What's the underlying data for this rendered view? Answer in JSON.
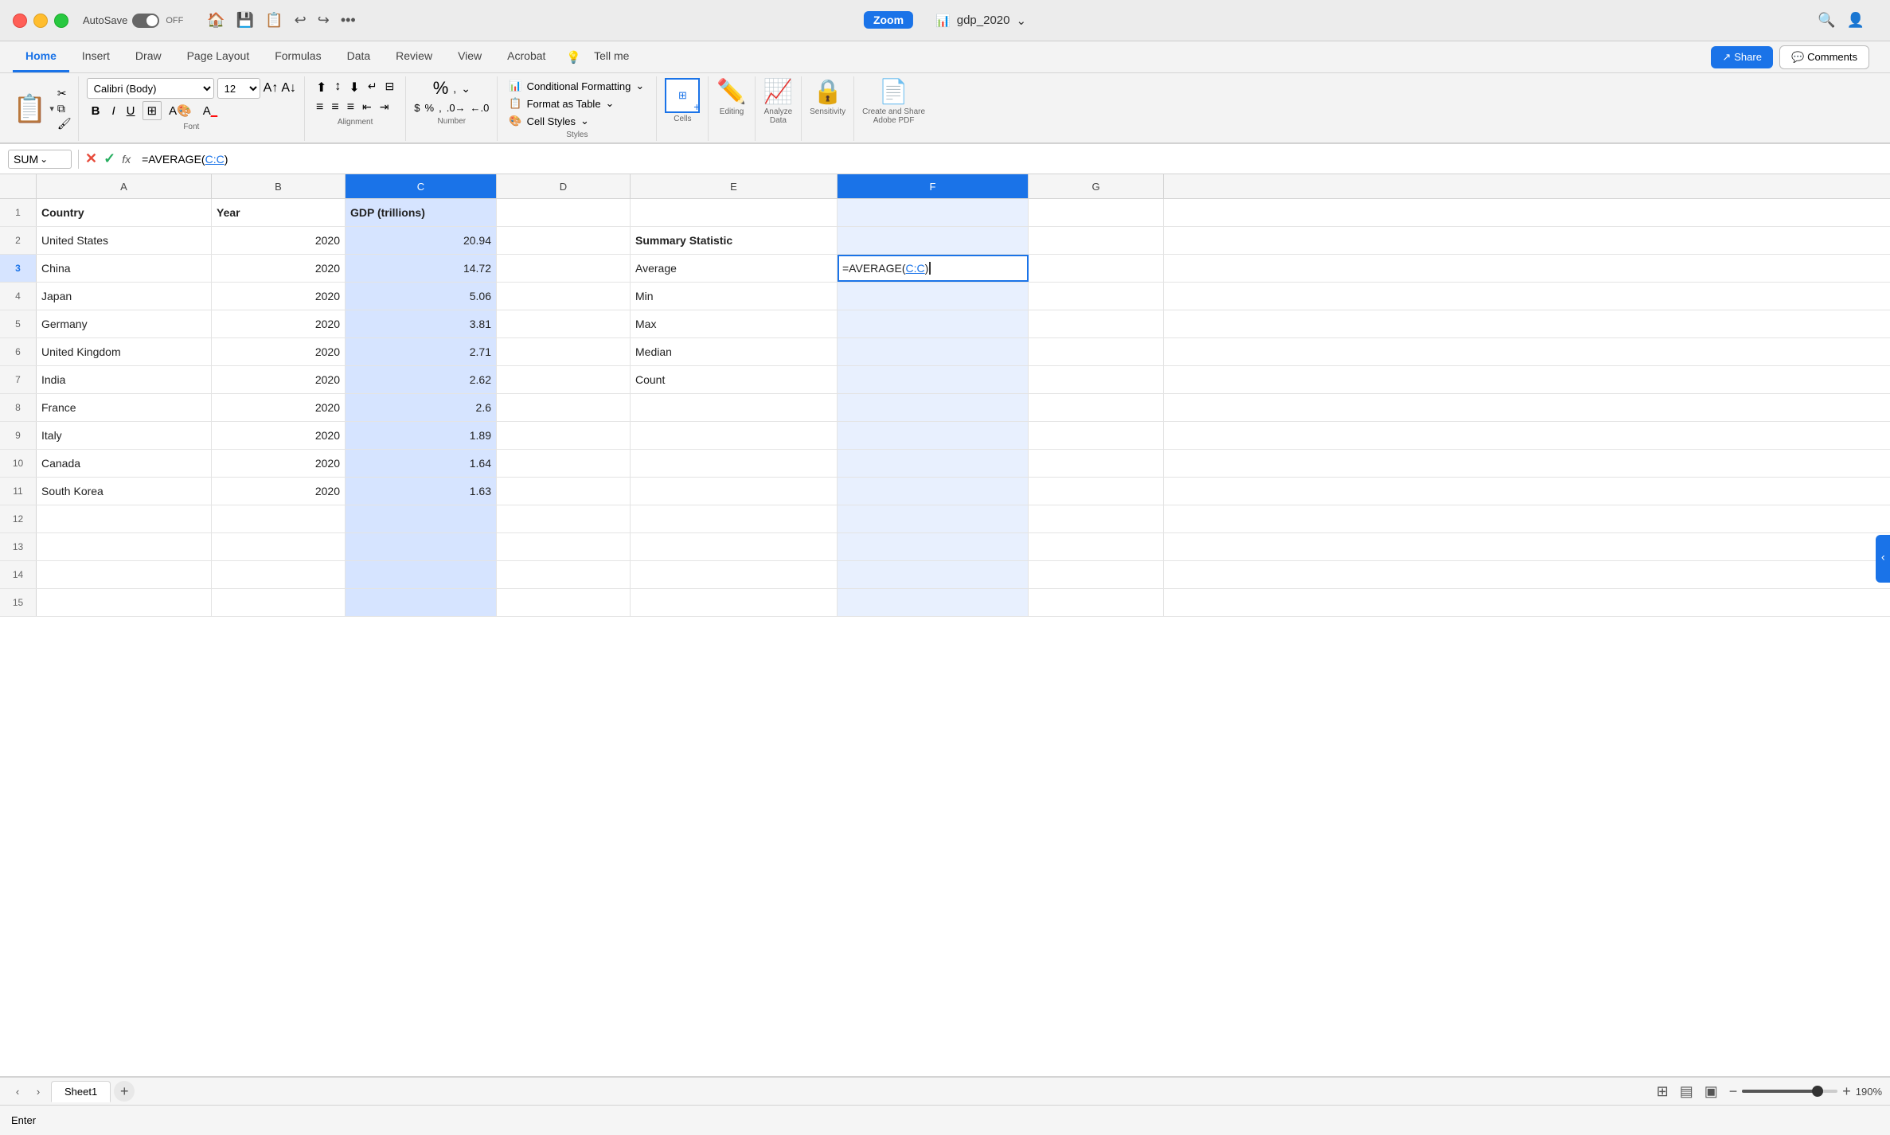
{
  "titleBar": {
    "appName": "AutoSave",
    "toggleState": "OFF",
    "fileName": "gdp_2020",
    "zoomApp": "Zoom",
    "icons": [
      "home",
      "save",
      "save-as",
      "back",
      "forward",
      "ellipsis"
    ]
  },
  "ribbon": {
    "tabs": [
      "Home",
      "Insert",
      "Draw",
      "Page Layout",
      "Formulas",
      "Data",
      "Review",
      "View",
      "Acrobat",
      "Tell me"
    ],
    "activeTab": "Home",
    "share": "Share",
    "comments": "Comments",
    "groups": {
      "paste": "Paste",
      "font": {
        "family": "Calibri (Body)",
        "size": "12"
      },
      "number": "Number",
      "styles": {
        "conditionalFormatting": "Conditional Formatting",
        "formatAsTable": "Format as Table",
        "cellStyles": "Cell Styles"
      },
      "cells": "Cells",
      "editing": "Editing",
      "analyzeData": "Analyze Data",
      "sensitivity": "Sensitivity",
      "createShare": "Create and Share Adobe PDF"
    }
  },
  "formulaBar": {
    "cellRef": "SUM",
    "formula": "=AVERAGE(C:C)"
  },
  "columns": {
    "headers": [
      "A",
      "B",
      "C",
      "D",
      "E",
      "F",
      "G"
    ],
    "widths": [
      220,
      168,
      190,
      168,
      260,
      240,
      170
    ]
  },
  "rows": [
    {
      "num": 1,
      "cells": [
        "Country",
        "Year",
        "GDP (trillions)",
        "",
        "",
        "",
        ""
      ]
    },
    {
      "num": 2,
      "cells": [
        "United States",
        "2020",
        "20.94",
        "",
        "Summary Statistic",
        "",
        ""
      ]
    },
    {
      "num": 3,
      "cells": [
        "China",
        "2020",
        "14.72",
        "",
        "Average",
        "=AVERAGE(C:C)",
        ""
      ]
    },
    {
      "num": 4,
      "cells": [
        "Japan",
        "2020",
        "5.06",
        "",
        "Min",
        "",
        ""
      ]
    },
    {
      "num": 5,
      "cells": [
        "Germany",
        "2020",
        "3.81",
        "",
        "Max",
        "",
        ""
      ]
    },
    {
      "num": 6,
      "cells": [
        "United Kingdom",
        "2020",
        "2.71",
        "",
        "Median",
        "",
        ""
      ]
    },
    {
      "num": 7,
      "cells": [
        "India",
        "2020",
        "2.62",
        "",
        "Count",
        "",
        ""
      ]
    },
    {
      "num": 8,
      "cells": [
        "France",
        "2020",
        "2.6",
        "",
        "",
        "",
        ""
      ]
    },
    {
      "num": 9,
      "cells": [
        "Italy",
        "2020",
        "1.89",
        "",
        "",
        "",
        ""
      ]
    },
    {
      "num": 10,
      "cells": [
        "Canada",
        "2020",
        "1.64",
        "",
        "",
        "",
        ""
      ]
    },
    {
      "num": 11,
      "cells": [
        "South Korea",
        "2020",
        "1.63",
        "",
        "",
        "",
        ""
      ]
    },
    {
      "num": 12,
      "cells": [
        "",
        "",
        "",
        "",
        "",
        "",
        ""
      ]
    },
    {
      "num": 13,
      "cells": [
        "",
        "",
        "",
        "",
        "",
        "",
        ""
      ]
    },
    {
      "num": 14,
      "cells": [
        "",
        "",
        "",
        "",
        "",
        "",
        ""
      ]
    },
    {
      "num": 15,
      "cells": [
        "",
        "",
        "",
        "",
        "",
        "",
        ""
      ]
    }
  ],
  "sheetTabs": {
    "tabs": [
      "Sheet1"
    ],
    "activeTab": "Sheet1",
    "addLabel": "+"
  },
  "statusBar": {
    "mode": "Enter",
    "zoomPercent": "190%"
  }
}
